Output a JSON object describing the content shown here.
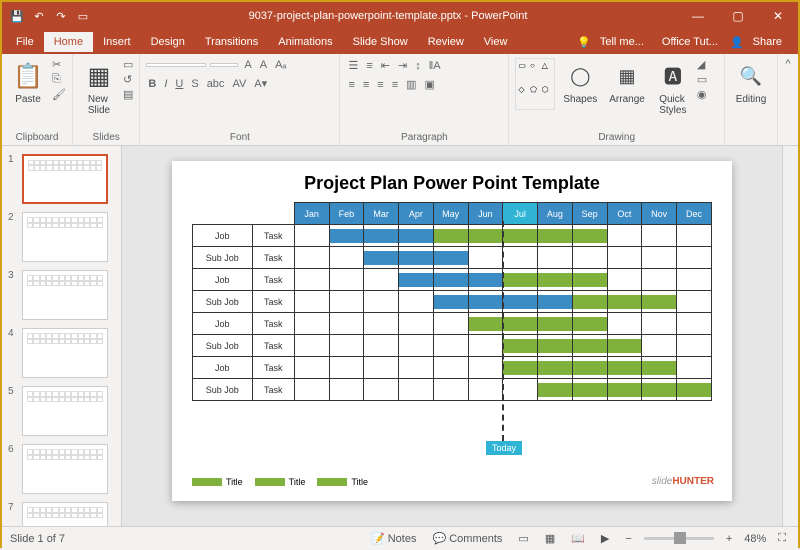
{
  "titlebar": {
    "filename": "9037-project-plan-powerpoint-template.pptx - PowerPoint"
  },
  "tabs": [
    "File",
    "Home",
    "Insert",
    "Design",
    "Transitions",
    "Animations",
    "Slide Show",
    "Review",
    "View"
  ],
  "tellme": "Tell me...",
  "officetut": "Office Tut...",
  "share": "Share",
  "ribbon": {
    "paste": "Paste",
    "newslide": "New\nSlide",
    "clipboard": "Clipboard",
    "slides": "Slides",
    "font": "Font",
    "paragraph": "Paragraph",
    "drawing": "Drawing",
    "editing": "Editing",
    "shapes": "Shapes",
    "arrange": "Arrange",
    "quickstyles": "Quick\nStyles"
  },
  "slide": {
    "title": "Project Plan Power Point Template",
    "months": [
      "Jan",
      "Feb",
      "Mar",
      "Apr",
      "May",
      "Jun",
      "Jul",
      "Aug",
      "Sep",
      "Oct",
      "Nov",
      "Dec"
    ],
    "current_month_idx": 6,
    "rows": [
      {
        "label": "Job",
        "task": "Task",
        "bars": [
          {
            "start": 1,
            "end": 4,
            "color": "blue"
          },
          {
            "start": 4,
            "end": 9,
            "color": "green"
          }
        ]
      },
      {
        "label": "Sub Job",
        "task": "Task",
        "bars": [
          {
            "start": 2,
            "end": 5,
            "color": "blue"
          }
        ]
      },
      {
        "label": "Job",
        "task": "Task",
        "bars": [
          {
            "start": 3,
            "end": 6,
            "color": "blue"
          },
          {
            "start": 6,
            "end": 9,
            "color": "green"
          }
        ]
      },
      {
        "label": "Sub Job",
        "task": "Task",
        "bars": [
          {
            "start": 4,
            "end": 8,
            "color": "blue"
          },
          {
            "start": 8,
            "end": 11,
            "color": "green"
          }
        ]
      },
      {
        "label": "Job",
        "task": "Task",
        "bars": [
          {
            "start": 5,
            "end": 9,
            "color": "green"
          }
        ]
      },
      {
        "label": "Sub Job",
        "task": "Task",
        "bars": [
          {
            "start": 6,
            "end": 10,
            "color": "green"
          }
        ]
      },
      {
        "label": "Job",
        "task": "Task",
        "bars": [
          {
            "start": 6,
            "end": 11,
            "color": "green"
          }
        ]
      },
      {
        "label": "Sub Job",
        "task": "Task",
        "bars": [
          {
            "start": 7,
            "end": 12,
            "color": "green"
          }
        ]
      }
    ],
    "today": "Today",
    "legend": [
      "Title",
      "Title",
      "Title"
    ],
    "watermark_a": "slide",
    "watermark_b": "HUNTER"
  },
  "status": {
    "slideinfo": "Slide 1 of 7",
    "notes": "Notes",
    "comments": "Comments",
    "zoom": "48%"
  },
  "thumbcount": 7
}
